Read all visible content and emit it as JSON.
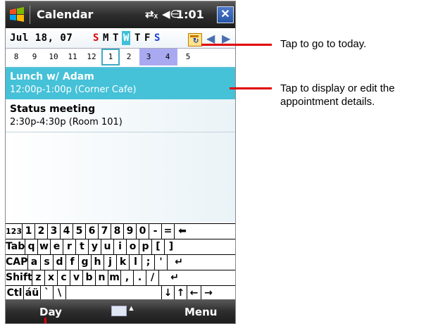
{
  "titlebar": {
    "title": "Calendar",
    "clock": "1:01",
    "close": "✕",
    "icons": [
      "windows-start-icon",
      "connectivity-icon",
      "volume-icon"
    ]
  },
  "date_header": {
    "date": "Jul 18, 07",
    "weekdays": [
      {
        "label": "S",
        "color": "#e00000"
      },
      {
        "label": "M",
        "color": "#000000"
      },
      {
        "label": "T",
        "color": "#000000"
      },
      {
        "label": "W",
        "color": "#ffffff",
        "selected": true
      },
      {
        "label": "T",
        "color": "#000000"
      },
      {
        "label": "F",
        "color": "#000000"
      },
      {
        "label": "S",
        "color": "#1a3fd8"
      }
    ],
    "prev": "◀",
    "next": "▶"
  },
  "day_strip": {
    "days": [
      "8",
      "9",
      "10",
      "11",
      "12",
      "1",
      "2",
      "3",
      "4",
      "5"
    ],
    "highlighted": [
      "3",
      "4"
    ],
    "selected_cell": "1"
  },
  "appointments": [
    {
      "title": "Lunch w/ Adam",
      "detail": "12:00p-1:00p (Corner Cafe)",
      "selected": true
    },
    {
      "title": "Status meeting",
      "detail": "2:30p-4:30p (Room 101)",
      "selected": false
    }
  ],
  "keyboard": {
    "row1": [
      "123",
      "1",
      "2",
      "3",
      "4",
      "5",
      "6",
      "7",
      "8",
      "9",
      "0",
      "-",
      "=",
      "⬅"
    ],
    "row2": [
      "Tab",
      "q",
      "w",
      "e",
      "r",
      "t",
      "y",
      "u",
      "i",
      "o",
      "p",
      "[",
      "]"
    ],
    "row3": [
      "CAP",
      "a",
      "s",
      "d",
      "f",
      "g",
      "h",
      "j",
      "k",
      "l",
      ";",
      "'",
      "↵"
    ],
    "row4": [
      "Shift",
      "z",
      "x",
      "c",
      "v",
      "b",
      "n",
      "m",
      ",",
      ".",
      "/",
      "↵"
    ],
    "row5": [
      "Ctl",
      "áü",
      "`",
      "\\",
      "",
      "↓",
      "↑",
      "←",
      "→"
    ]
  },
  "bottom_bar": {
    "left_softkey": "Day",
    "right_softkey": "Menu"
  },
  "callouts": {
    "today": "Tap to go to today.",
    "appointment_line1": "Tap to display or edit the",
    "appointment_line2": "appointment details."
  },
  "colors": {
    "accent": "#45c1d8",
    "highlight": "#a9a9f2",
    "callout": "#e00000"
  }
}
